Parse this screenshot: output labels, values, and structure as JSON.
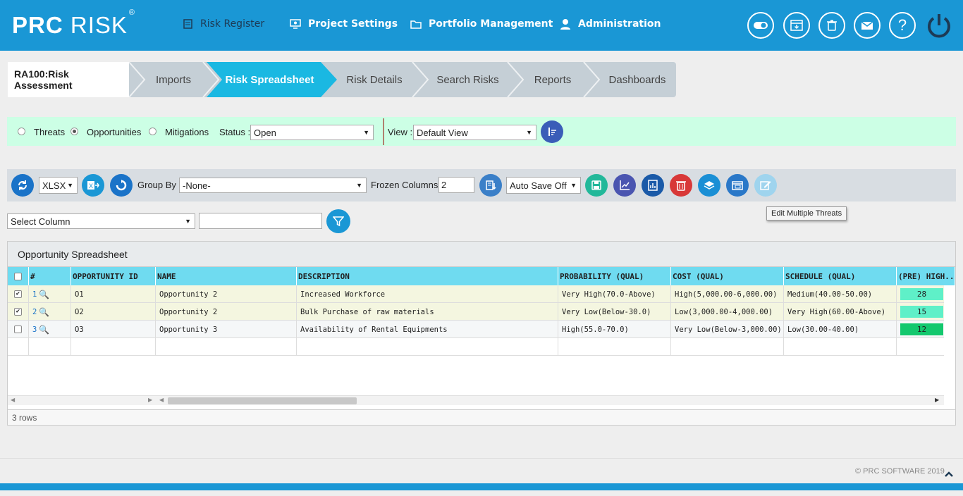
{
  "app": {
    "logo_bold": "PRC",
    "logo_light": "RISK",
    "logo_mark": "®"
  },
  "nav": {
    "risk_register": "Risk Register",
    "project_settings": "Project Settings",
    "portfolio_management": "Portfolio Management",
    "administration": "Administration"
  },
  "top_icons": [
    "toggle-icon",
    "download-box-icon",
    "trash-icon",
    "mail-icon",
    "help-icon",
    "power-icon"
  ],
  "breadcrumb": {
    "current": "RA100:Risk Assessment",
    "steps": [
      "Imports",
      "Risk Spreadsheet",
      "Risk Details",
      "Search Risks",
      "Reports",
      "Dashboards"
    ],
    "active_index": 1
  },
  "filter": {
    "threats": "Threats",
    "opportunities": "Opportunities",
    "mitigations": "Mitigations",
    "selected": "Opportunities",
    "status_label": "Status :",
    "status_value": "Open",
    "view_label": "View :",
    "view_value": "Default View"
  },
  "toolbar": {
    "format": "XLSX",
    "group_by_label": "Group By :",
    "group_by_value": "-None-",
    "frozen_label": "Frozen Columns :",
    "frozen_value": "2",
    "autosave_value": "Auto Save Off",
    "tooltip": "Edit Multiple Threats"
  },
  "search": {
    "column_value": "Select Column",
    "text_value": ""
  },
  "sheet": {
    "title": "Opportunity Spreadsheet",
    "columns": [
      "#",
      "OPPORTUNITY ID",
      "NAME",
      "DESCRIPTION",
      "PROBABILITY (QUAL)",
      "COST (QUAL)",
      "SCHEDULE (QUAL)",
      "(PRE) HIGH..."
    ],
    "rows": [
      {
        "num": "1",
        "id": "O1",
        "name": "Opportunity 2",
        "desc": "Increased Workforce",
        "prob": "Very High(70.0-Above)",
        "cost": "High(5,000.00-6,000.00)",
        "sched": "Medium(40.00-50.00)",
        "rank": "28",
        "checked": true,
        "rank_color": "#5ff0c8"
      },
      {
        "num": "2",
        "id": "O2",
        "name": "Opportunity 2",
        "desc": "Bulk Purchase of raw materials",
        "prob": "Very Low(Below-30.0)",
        "cost": "Low(3,000.00-4,000.00)",
        "sched": "Very High(60.00-Above)",
        "rank": "15",
        "checked": true,
        "rank_color": "#5ff0c8"
      },
      {
        "num": "3",
        "id": "O3",
        "name": "Opportunity 3",
        "desc": "Availability of Rental Equipments",
        "prob": "High(55.0-70.0)",
        "cost": "Very Low(Below-3,000.00)",
        "sched": "Low(30.00-40.00)",
        "rank": "12",
        "checked": false,
        "rank_color": "#14c86e"
      }
    ],
    "row_count": "3 rows"
  },
  "footer": {
    "copyright": "© PRC SOFTWARE 2019"
  },
  "colors": {
    "brand": "#1a97d5",
    "active_crumb": "#1ab8e2",
    "filter_bg": "#ccffe5",
    "header_cyan": "#6fdbf0"
  }
}
